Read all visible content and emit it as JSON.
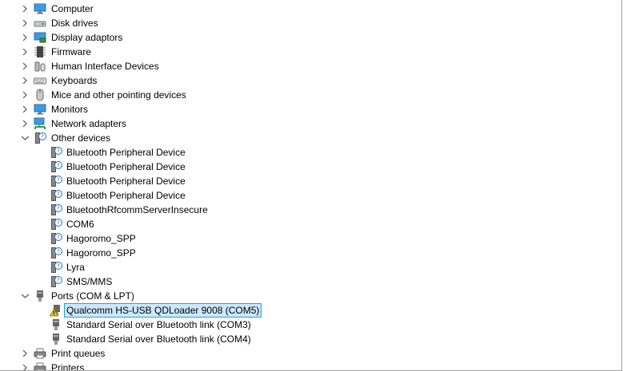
{
  "tree": {
    "computer": "Computer",
    "disk_drives": "Disk drives",
    "display_adaptors": "Display adaptors",
    "firmware": "Firmware",
    "hid": "Human Interface Devices",
    "keyboards": "Keyboards",
    "mice": "Mice and other pointing devices",
    "monitors": "Monitors",
    "network": "Network adapters",
    "other_devices": {
      "label": "Other devices",
      "children": [
        "Bluetooth Peripheral Device",
        "Bluetooth Peripheral Device",
        "Bluetooth Peripheral Device",
        "Bluetooth Peripheral Device",
        "BluetoothRfcommServerInsecure",
        "COM6",
        "Hagoromo_SPP",
        "Hagoromo_SPP",
        "Lyra",
        "SMS/MMS"
      ]
    },
    "ports": {
      "label": "Ports (COM & LPT)",
      "children": [
        "Qualcomm HS-USB QDLoader 9008 (COM5)",
        "Standard Serial over Bluetooth link (COM3)",
        "Standard Serial over Bluetooth link (COM4)"
      ]
    },
    "print_queues": "Print queues",
    "printers": "Printers"
  },
  "colors": {
    "selection_bg": "#cce8ff",
    "selection_border": "#26a0da",
    "warning": "#f5c400"
  }
}
